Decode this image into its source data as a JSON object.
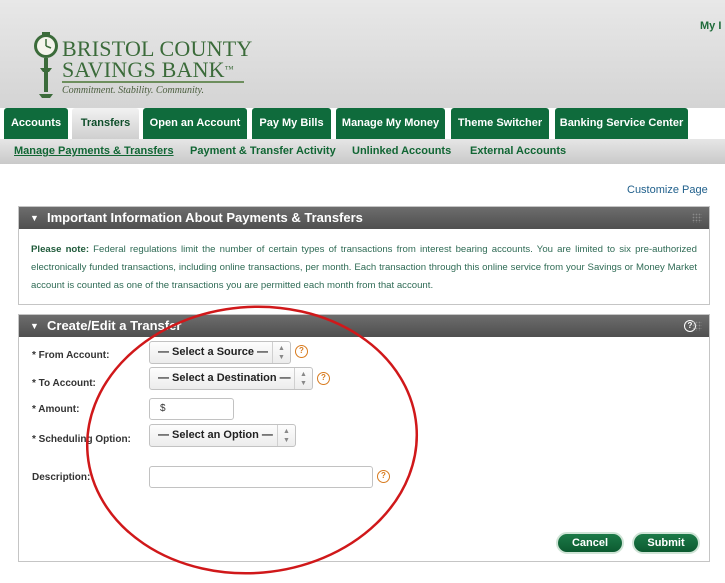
{
  "header": {
    "bank_name_line1": "BRISTOL COUNTY",
    "bank_name_line2": "SAVINGS BANK",
    "trademark": "™",
    "tagline": "Commitment. Stability. Community.",
    "top_right_link": "My I"
  },
  "tabs": [
    {
      "label": "Accounts"
    },
    {
      "label": "Transfers"
    },
    {
      "label": "Open an Account"
    },
    {
      "label": "Pay My Bills"
    },
    {
      "label": "Manage My Money"
    },
    {
      "label": "Theme Switcher"
    },
    {
      "label": "Banking Service Center"
    }
  ],
  "subnav": [
    {
      "label": "Manage Payments & Transfers"
    },
    {
      "label": "Payment & Transfer Activity"
    },
    {
      "label": "Unlinked Accounts"
    },
    {
      "label": "External Accounts"
    }
  ],
  "customize_link": "Customize Page",
  "info_panel": {
    "title": "Important Information About Payments & Transfers",
    "note_label": "Please note:",
    "note_text": " Federal regulations limit the number of certain types of transactions from interest bearing accounts. You are limited to six pre-authorized electronically funded transactions, including online transactions, per month. Each transaction through this online service from your Savings or Money Market account is counted as one of the transactions you are permitted each month from that account."
  },
  "transfer_panel": {
    "title": "Create/Edit a Transfer",
    "from_label": "* From Account:",
    "from_value": "— Select a Source —",
    "to_label": "* To Account:",
    "to_value": "— Select a Destination —",
    "amount_label": "* Amount:",
    "amount_value": "$",
    "schedule_label": "* Scheduling Option:",
    "schedule_value": "— Select an Option —",
    "description_label": "Description:",
    "description_value": "",
    "cancel_label": "Cancel",
    "submit_label": "Submit"
  },
  "colors": {
    "brand_green": "#0f6b3c",
    "panel_header": "#5a5a5a",
    "annotation_red": "#d0181a",
    "help_orange": "#d87b1f"
  },
  "icons": [
    "clock-tower-logo-icon",
    "collapse-arrow-icon",
    "help-icon",
    "grip-icon",
    "spinner-icon"
  ]
}
